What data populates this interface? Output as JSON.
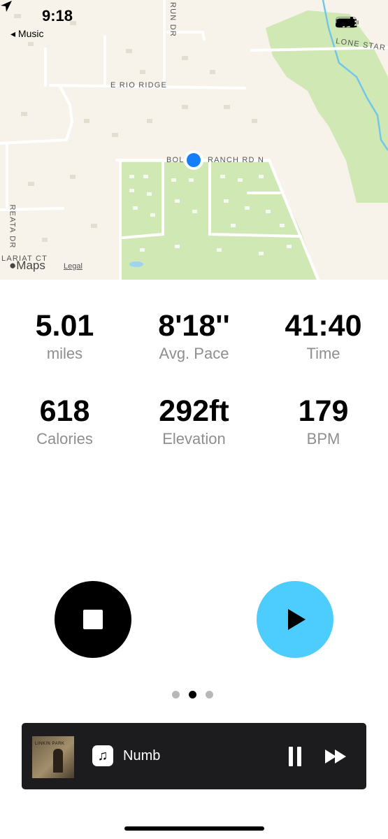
{
  "status_bar": {
    "time": "9:18",
    "back_label": "◂ Music",
    "network": "LTE"
  },
  "map": {
    "streets": [
      "E RIO RIDGE",
      "BOL",
      "RANCH RD N",
      "LONE STAR",
      "RUN DR",
      "LARIAT CT",
      "REATA DR"
    ],
    "attribution": "Maps",
    "legal": "Legal",
    "colors": {
      "land": "#f7f3ea",
      "park": "#cfe8b4",
      "location": "#147efb",
      "water": "#74c6e8"
    }
  },
  "stats": [
    {
      "value": "5.01",
      "label": "miles"
    },
    {
      "value": "8'18''",
      "label": "Avg. Pace"
    },
    {
      "value": "41:40",
      "label": "Time"
    },
    {
      "value": "618",
      "label": "Calories"
    },
    {
      "value": "292ft",
      "label": "Elevation"
    },
    {
      "value": "179",
      "label": "BPM"
    }
  ],
  "controls": {
    "stop_icon": "stop-icon",
    "resume_icon": "play-icon",
    "accent": "#4ccdfd"
  },
  "pager": {
    "count": 3,
    "active": 2
  },
  "now_playing": {
    "album_text": "LINKIN PARK",
    "title": "Numb",
    "app_icon": "♫"
  }
}
